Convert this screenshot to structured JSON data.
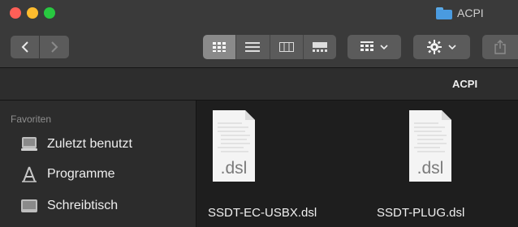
{
  "window": {
    "title": "ACPI",
    "title_icon": "folder-icon"
  },
  "toolbar": {
    "back_icon": "chevron-left-icon",
    "forward_icon": "chevron-right-icon",
    "view_modes": [
      "icon-view",
      "list-view",
      "column-view",
      "gallery-view"
    ],
    "group_icon": "group-grid-icon",
    "action_icon": "gear-icon",
    "share_icon": "share-icon"
  },
  "pathbar": {
    "label": "ACPI"
  },
  "sidebar": {
    "heading": "Favoriten",
    "items": [
      {
        "label": "Zuletzt benutzt",
        "icon": "recents-icon"
      },
      {
        "label": "Programme",
        "icon": "applications-icon"
      },
      {
        "label": "Schreibtisch",
        "icon": "desktop-icon"
      }
    ]
  },
  "files": [
    {
      "name": "SSDT-EC-USBX.dsl",
      "ext": ".dsl"
    },
    {
      "name": "SSDT-PLUG.dsl",
      "ext": ".dsl"
    }
  ],
  "colors": {
    "close": "#ff5f57",
    "minimize": "#febc2e",
    "maximize": "#28c840",
    "folder": "#4a9be0"
  }
}
